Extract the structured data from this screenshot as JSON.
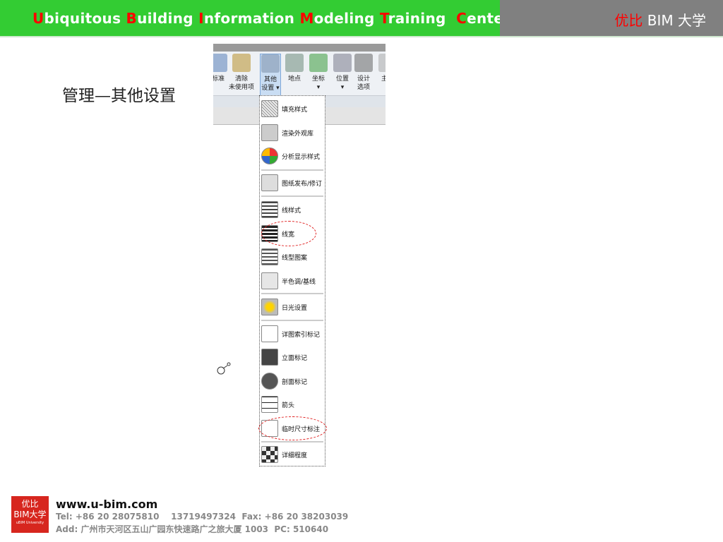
{
  "header": {
    "title_words": [
      {
        "initial": "U",
        "rest": "biquitous "
      },
      {
        "initial": "B",
        "rest": "uilding "
      },
      {
        "initial": "I",
        "rest": "nformation "
      },
      {
        "initial": "M",
        "rest": "odeling "
      },
      {
        "initial": "T",
        "rest": "raining  "
      },
      {
        "initial": "C",
        "rest": "enter"
      }
    ],
    "brand_cn": "优比",
    "brand_rest": " BIM 大学"
  },
  "slide_title": "管理—其他设置",
  "ribbon": {
    "buttons": [
      {
        "label1": "",
        "label2": "标准"
      },
      {
        "label1": "清除",
        "label2": "未使用项"
      },
      {
        "label1": "其他",
        "label2": "设置 ▾"
      },
      {
        "label1": "地点",
        "label2": ""
      },
      {
        "label1": "坐标",
        "label2": "▾"
      },
      {
        "label1": "位置",
        "label2": "▾"
      },
      {
        "label1": "设计",
        "label2": "选项"
      },
      {
        "label1": "",
        "label2": "主模"
      }
    ]
  },
  "menu": {
    "items": [
      "填充样式",
      "渲染外观库",
      "分析显示样式",
      "图纸发布/修订",
      "线样式",
      "线宽",
      "线型图案",
      "半色调/基线",
      "日光设置",
      "详图索引标记",
      "立面标记",
      "剖面标记",
      "箭头",
      "临时尺寸标注",
      "详细程度"
    ]
  },
  "footer": {
    "logo_line1": "优比",
    "logo_line2": "BIM大学",
    "logo_line3": "uBIM University",
    "website": "www.u-bim.com",
    "tel": "Tel: +86 20 28075810    13719497324  Fax: +86 20 38203039",
    "address": "Add: 广州市天河区五山广园东快速路广之旅大厦 1003  PC: 510640"
  },
  "colors": {
    "green": "#33cc33",
    "gray": "#808080",
    "red": "#ff0000"
  }
}
